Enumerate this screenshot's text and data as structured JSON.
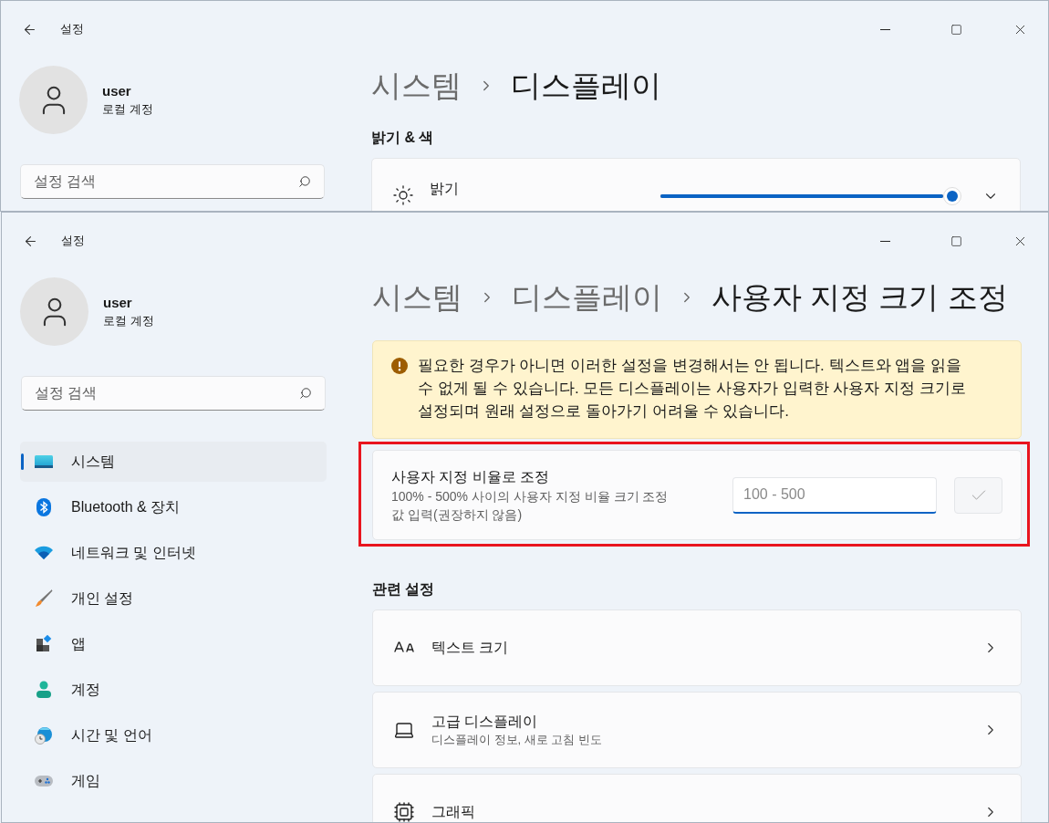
{
  "back_window": {
    "title": "설정",
    "user": {
      "name": "user",
      "account": "로컬 계정"
    },
    "search": {
      "placeholder": "설정 검색"
    },
    "breadcrumb": [
      "시스템",
      "디스플레이"
    ],
    "section_heading": "밝기 & 색",
    "brightness": {
      "label": "밝기",
      "level": 1,
      "expanded": false
    }
  },
  "front_window": {
    "title": "설정",
    "user": {
      "name": "user",
      "account": "로컬 계정"
    },
    "search": {
      "placeholder": "설정 검색"
    },
    "nav": [
      {
        "label": "시스템",
        "selected": true
      },
      {
        "label": "Bluetooth & 장치",
        "selected": false
      },
      {
        "label": "네트워크 및 인터넷",
        "selected": false
      },
      {
        "label": "개인 설정",
        "selected": false
      },
      {
        "label": "앱",
        "selected": false
      },
      {
        "label": "계정",
        "selected": false
      },
      {
        "label": "시간 및 언어",
        "selected": false
      },
      {
        "label": "게임",
        "selected": false
      }
    ],
    "breadcrumb": [
      "시스템",
      "디스플레이",
      "사용자 지정 크기 조정"
    ],
    "warning": "필요한 경우가 아니면 이러한 설정을 변경해서는 안 됩니다. 텍스트와 앱을 읽을 수 없게 될 수 있습니다. 모든 디스플레이는 사용자가 입력한 사용자 지정 크기로 설정되며 원래 설정으로 돌아가기 어려울 수 있습니다.",
    "custom_scaling": {
      "label": "사용자 지정 비율로 조정",
      "description": "100% - 500% 사이의 사용자 지정 비율 크기 조정 값 입력(권장하지 않음)",
      "placeholder": "100 - 500",
      "apply_disabled": true,
      "highlighted": true
    },
    "related_heading": "관련 설정",
    "related": [
      {
        "label": "텍스트 크기"
      },
      {
        "label": "고급 디스플레이",
        "description": "디스플레이 정보, 새로 고침 빈도"
      },
      {
        "label": "그래픽"
      }
    ]
  }
}
